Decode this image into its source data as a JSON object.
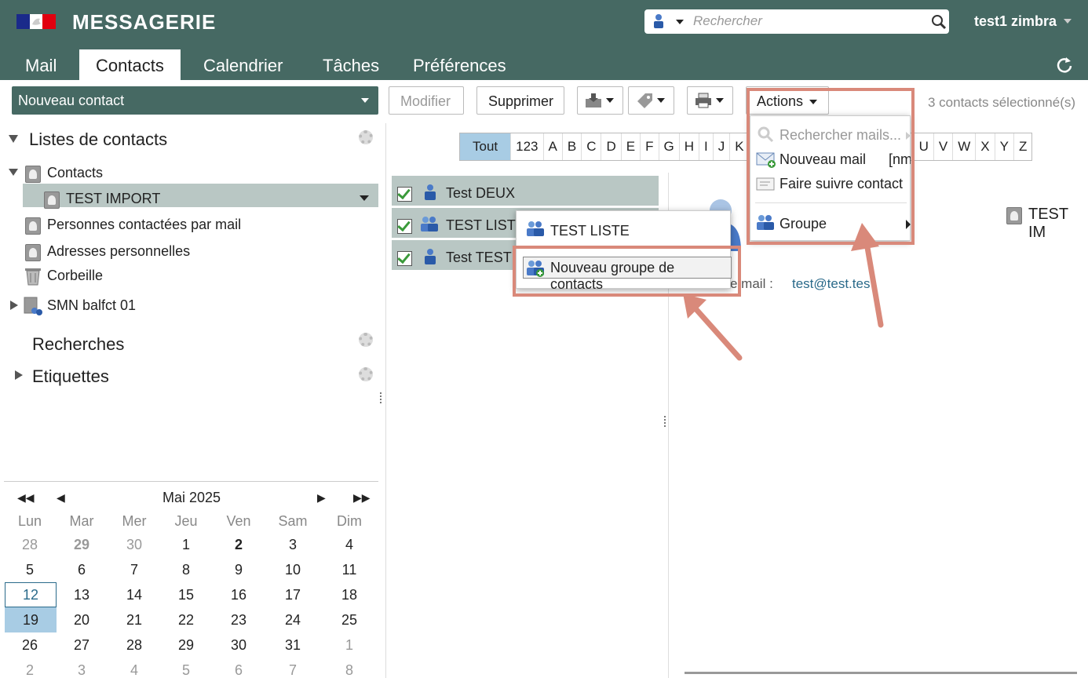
{
  "header": {
    "app_title": "MESSAGERIE",
    "search_placeholder": "Rechercher",
    "user": "test1 zimbra",
    "tabs": [
      "Mail",
      "Contacts",
      "Calendrier",
      "Tâches",
      "Préférences"
    ],
    "active_tab": "Contacts"
  },
  "toolbar": {
    "new_contact": "Nouveau contact",
    "modify": "Modifier",
    "delete": "Supprimer",
    "actions": "Actions",
    "selected_count": "3 contacts sélectionné(s)"
  },
  "sidebar": {
    "contact_lists_heading": "Listes de contacts",
    "contacts": "Contacts",
    "test_import": "TEST IMPORT",
    "emailed_contacts": "Personnes contactées par mail",
    "personal_addresses": "Adresses personnelles",
    "trash": "Corbeille",
    "shared": "SMN balfct 01",
    "searches_heading": "Recherches",
    "tags_heading": "Etiquettes"
  },
  "calendar": {
    "month": "Mai 2025",
    "dow": [
      "Lun",
      "Mar",
      "Mer",
      "Jeu",
      "Ven",
      "Sam",
      "Dim"
    ],
    "weeks": [
      [
        "28",
        "29",
        "30",
        "1",
        "2",
        "3",
        "4"
      ],
      [
        "5",
        "6",
        "7",
        "8",
        "9",
        "10",
        "11"
      ],
      [
        "12",
        "13",
        "14",
        "15",
        "16",
        "17",
        "18"
      ],
      [
        "19",
        "20",
        "21",
        "22",
        "23",
        "24",
        "25"
      ],
      [
        "26",
        "27",
        "28",
        "29",
        "30",
        "31",
        "1"
      ],
      [
        "2",
        "3",
        "4",
        "5",
        "6",
        "7",
        "8"
      ]
    ]
  },
  "alpha": [
    "Tout",
    "123",
    "A",
    "B",
    "C",
    "D",
    "E",
    "F",
    "G",
    "H",
    "I",
    "J",
    "K"
  ],
  "alpha_tail": [
    "U",
    "V",
    "W",
    "X",
    "Y",
    "Z"
  ],
  "contacts_list": [
    "Test DEUX",
    "TEST LISTE",
    "Test TEST"
  ],
  "group_menu": {
    "item1": "TEST LISTE",
    "item2": "Nouveau groupe de contacts"
  },
  "actions_menu": {
    "search_mails": "Rechercher mails...",
    "new_mail": "Nouveau mail",
    "new_mail_shortcut": "[nm",
    "follow_contact": "Faire suivre contact",
    "group": "Groupe"
  },
  "detail": {
    "name": "TEST IM",
    "email_label": "e mail :",
    "email": "test@test.tes"
  },
  "colors": {
    "header_bg": "#466963",
    "selection": "#b9c7c4",
    "highlight": "#d9897a",
    "today_bg": "#a8cce4"
  }
}
